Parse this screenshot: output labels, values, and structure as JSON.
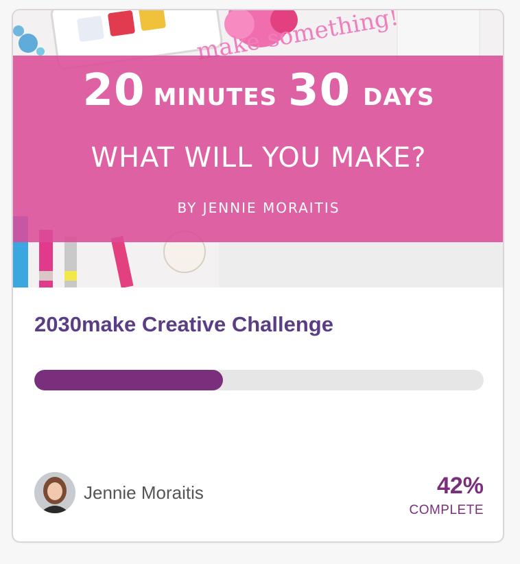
{
  "hero": {
    "line1_num1": "20",
    "line1_word1": "MINUTES",
    "line1_num2": "30",
    "line1_word2": "DAYS",
    "line2": "WHAT WILL YOU MAKE?",
    "line3": "BY JENNIE MORAITIS",
    "handwriting": "make something!!!",
    "banner_color": "#db4c98"
  },
  "course": {
    "title": "2030make Creative Challenge",
    "author": "Jennie Moraitis",
    "progress_percent": 42,
    "progress_label": "42%",
    "complete_label": "COMPLETE"
  },
  "colors": {
    "title": "#5a3e85",
    "accent": "#7a2f7c",
    "track": "#e6e6e6"
  }
}
